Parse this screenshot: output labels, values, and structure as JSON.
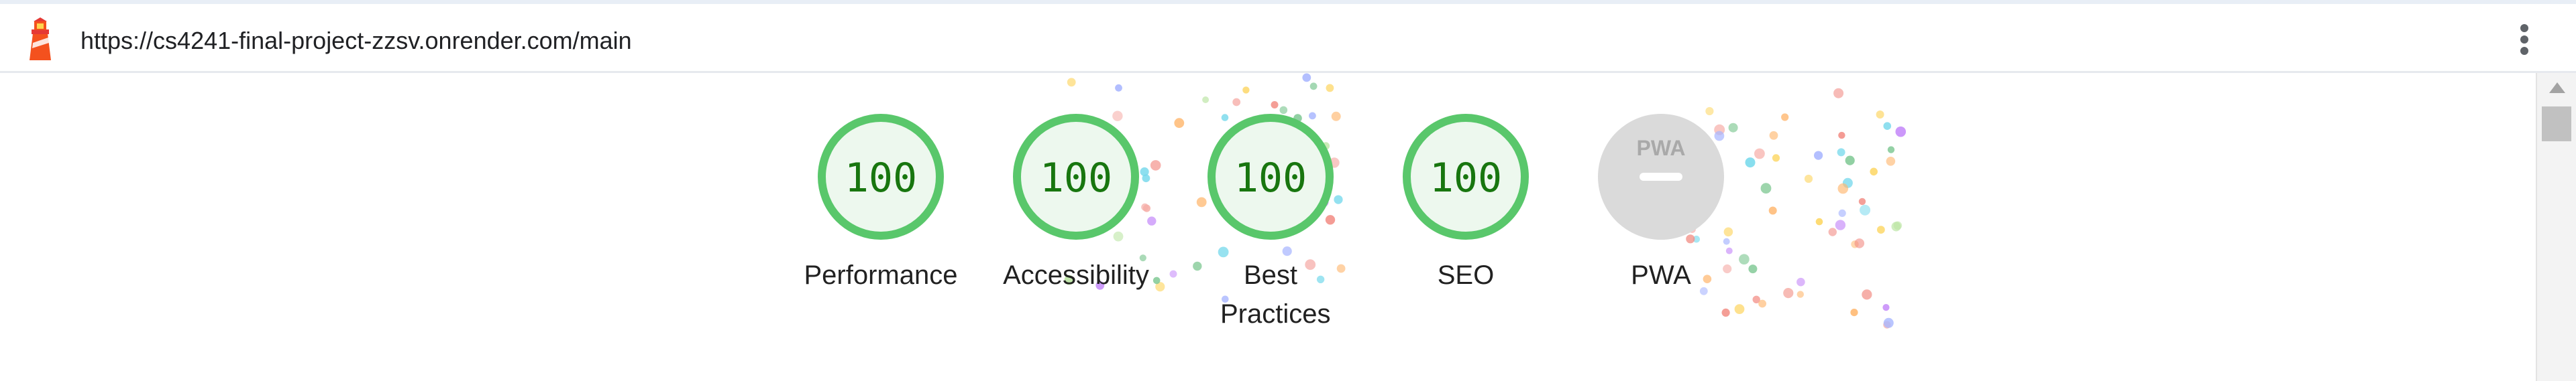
{
  "topbar": {
    "url": "https://cs4241-final-project-zzsv.onrender.com/main",
    "logo_icon": "lighthouse-icon",
    "menu_icon": "kebab-menu-icon"
  },
  "scores": [
    {
      "id": "performance",
      "value": "100",
      "label": "Performance"
    },
    {
      "id": "accessibility",
      "value": "100",
      "label": "Accessibility"
    },
    {
      "id": "best-practices",
      "value": "100",
      "label": "Best Practices"
    },
    {
      "id": "seo",
      "value": "100",
      "label": "SEO"
    }
  ],
  "pwa": {
    "badge_text": "PWA",
    "label": "PWA"
  },
  "colors": {
    "pass_ring": "#59c76b",
    "pass_fill": "#edf8ee",
    "pass_text": "#18760f",
    "pwa_fill": "#dadada",
    "pwa_text": "#a9a9a9"
  }
}
